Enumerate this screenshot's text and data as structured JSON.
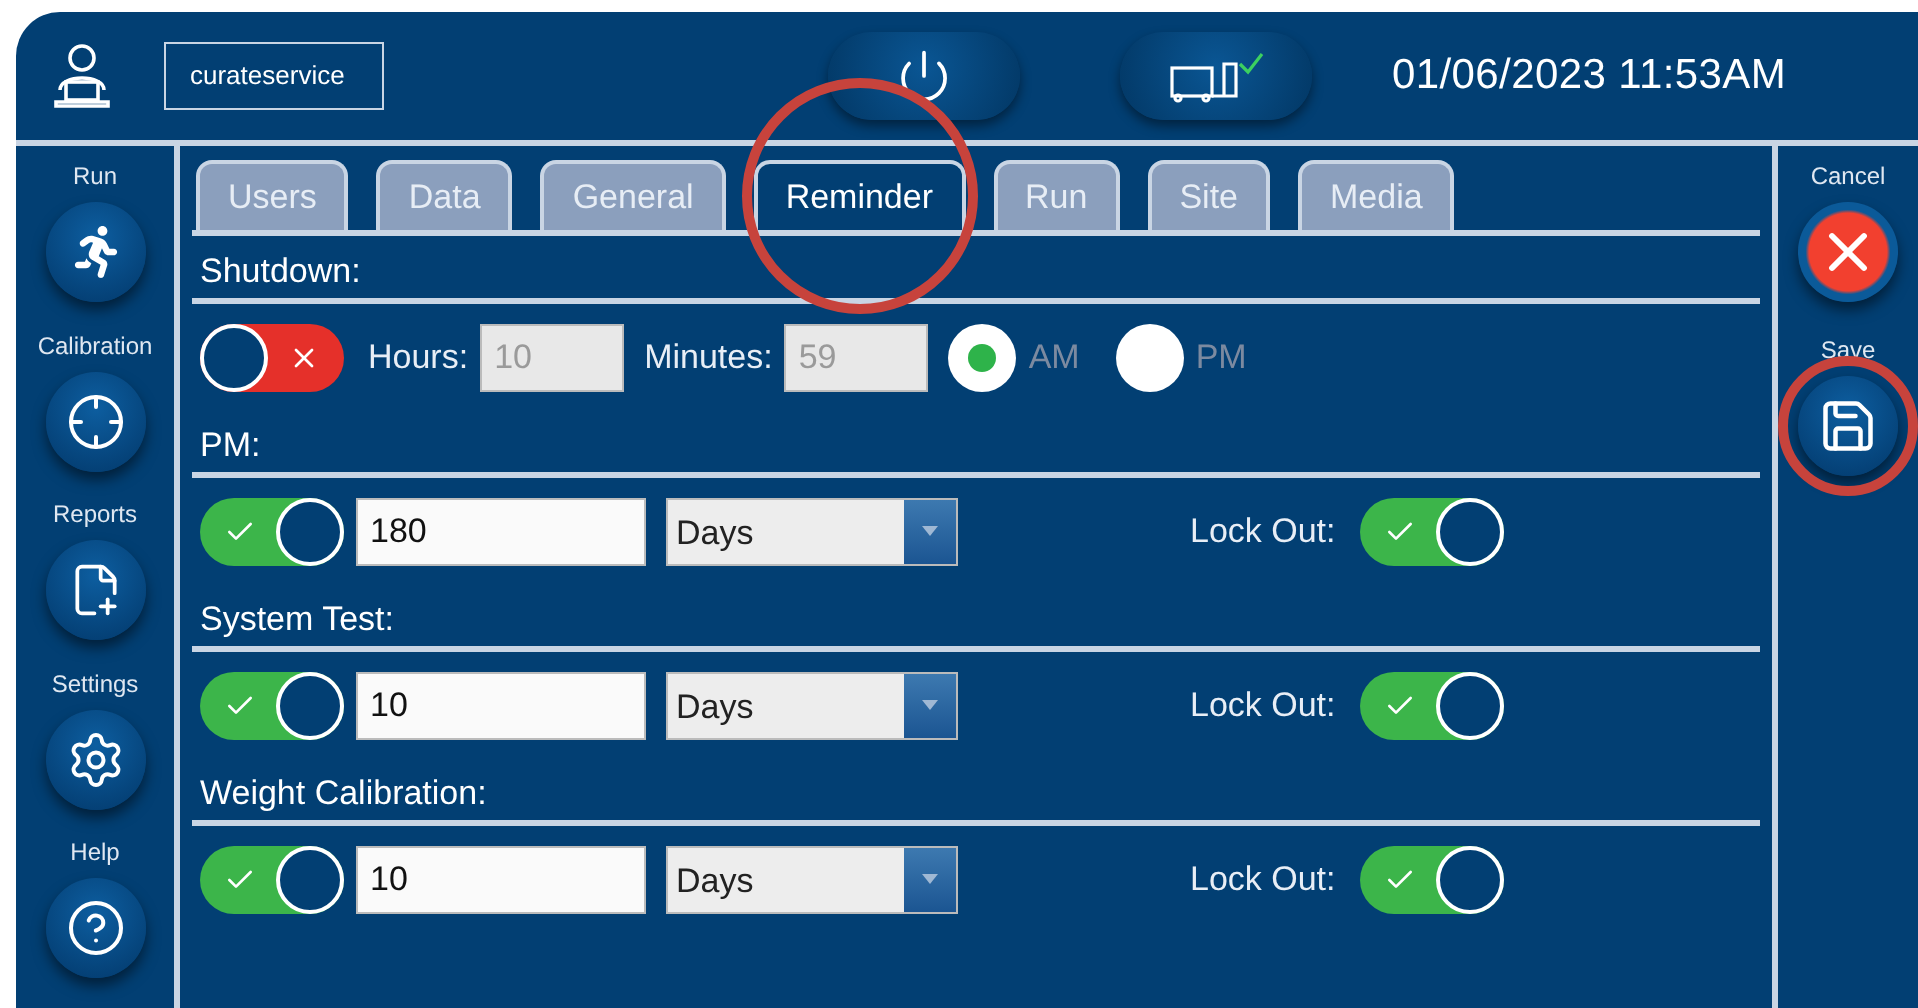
{
  "header": {
    "username": "curateservice",
    "device_connected": true,
    "datetime": "01/06/2023 11:53AM"
  },
  "nav": [
    {
      "label": "Run",
      "kind": "run"
    },
    {
      "label": "Calibration",
      "kind": "calibration"
    },
    {
      "label": "Reports",
      "kind": "reports"
    },
    {
      "label": "Settings",
      "kind": "settings"
    },
    {
      "label": "Help",
      "kind": "help"
    }
  ],
  "tabs": [
    {
      "label": "Users",
      "selected": false,
      "highlighted": false
    },
    {
      "label": "Data",
      "selected": false,
      "highlighted": false
    },
    {
      "label": "General",
      "selected": false,
      "highlighted": false
    },
    {
      "label": "Reminder",
      "selected": true,
      "highlighted": true
    },
    {
      "label": "Run",
      "selected": false,
      "highlighted": false
    },
    {
      "label": "Site",
      "selected": false,
      "highlighted": false
    },
    {
      "label": "Media",
      "selected": false,
      "highlighted": false
    }
  ],
  "sections": [
    {
      "title": "Shutdown:",
      "kind": "time",
      "enabled": false,
      "hours_label": "Hours:",
      "hours": "10",
      "minutes_label": "Minutes:",
      "minutes": "59",
      "disabled": true,
      "am_pm": [
        {
          "label": "AM",
          "selected": true
        },
        {
          "label": "PM",
          "selected": false
        }
      ]
    },
    {
      "title": "PM:",
      "kind": "interval",
      "enabled": true,
      "value": "180",
      "unit": "Days",
      "lockout_label": "Lock Out:",
      "lockout": true
    },
    {
      "title": "System Test:",
      "kind": "interval",
      "enabled": true,
      "value": "10",
      "unit": "Days",
      "lockout_label": "Lock Out:",
      "lockout": true
    },
    {
      "title": "Weight Calibration:",
      "kind": "interval",
      "enabled": true,
      "value": "10",
      "unit": "Days",
      "lockout_label": "Lock Out:",
      "lockout": true
    }
  ],
  "actions": [
    {
      "label": "Cancel",
      "kind": "cancel",
      "highlighted": false
    },
    {
      "label": "Save",
      "kind": "save",
      "highlighted": true
    }
  ]
}
